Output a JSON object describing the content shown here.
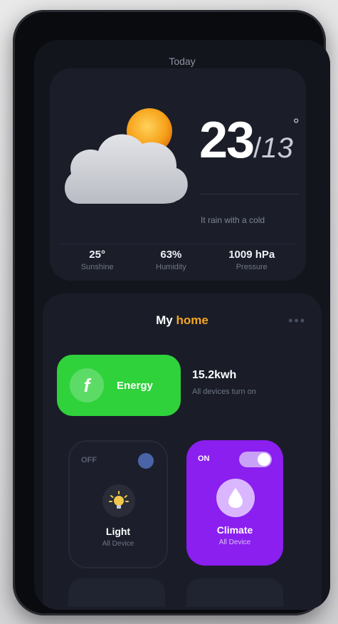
{
  "header": {
    "title": "Today"
  },
  "weather": {
    "temp_high": "23",
    "temp_separator": "/",
    "temp_low": "13",
    "degree_symbol": "°",
    "condition": "It rain with a cold",
    "stats": [
      {
        "value": "25°",
        "label": "Sunshine"
      },
      {
        "value": "63%",
        "label": "Humidity"
      },
      {
        "value": "1009 hPa",
        "label": "Pressure"
      }
    ]
  },
  "home": {
    "title_prefix": "My",
    "title_highlight": "home",
    "more_dots": "•••",
    "energy": {
      "label": "Energy",
      "icon_glyph": "f",
      "value": "15.2kwh",
      "sub": "All devices turn on"
    },
    "light": {
      "state": "OFF",
      "name": "Light",
      "sub": "All Device"
    },
    "climate": {
      "state": "ON",
      "name": "Climate",
      "sub": "All Device"
    }
  },
  "colors": {
    "accent_orange": "#f5a623",
    "energy_green": "#2fd23b",
    "climate_purple": "#8a1ff0",
    "background": "#13151d"
  },
  "icons": {
    "weather": "cloud-sun-icon",
    "energy": "energy-icon",
    "light": "bulb-icon",
    "climate": "drop-icon"
  }
}
